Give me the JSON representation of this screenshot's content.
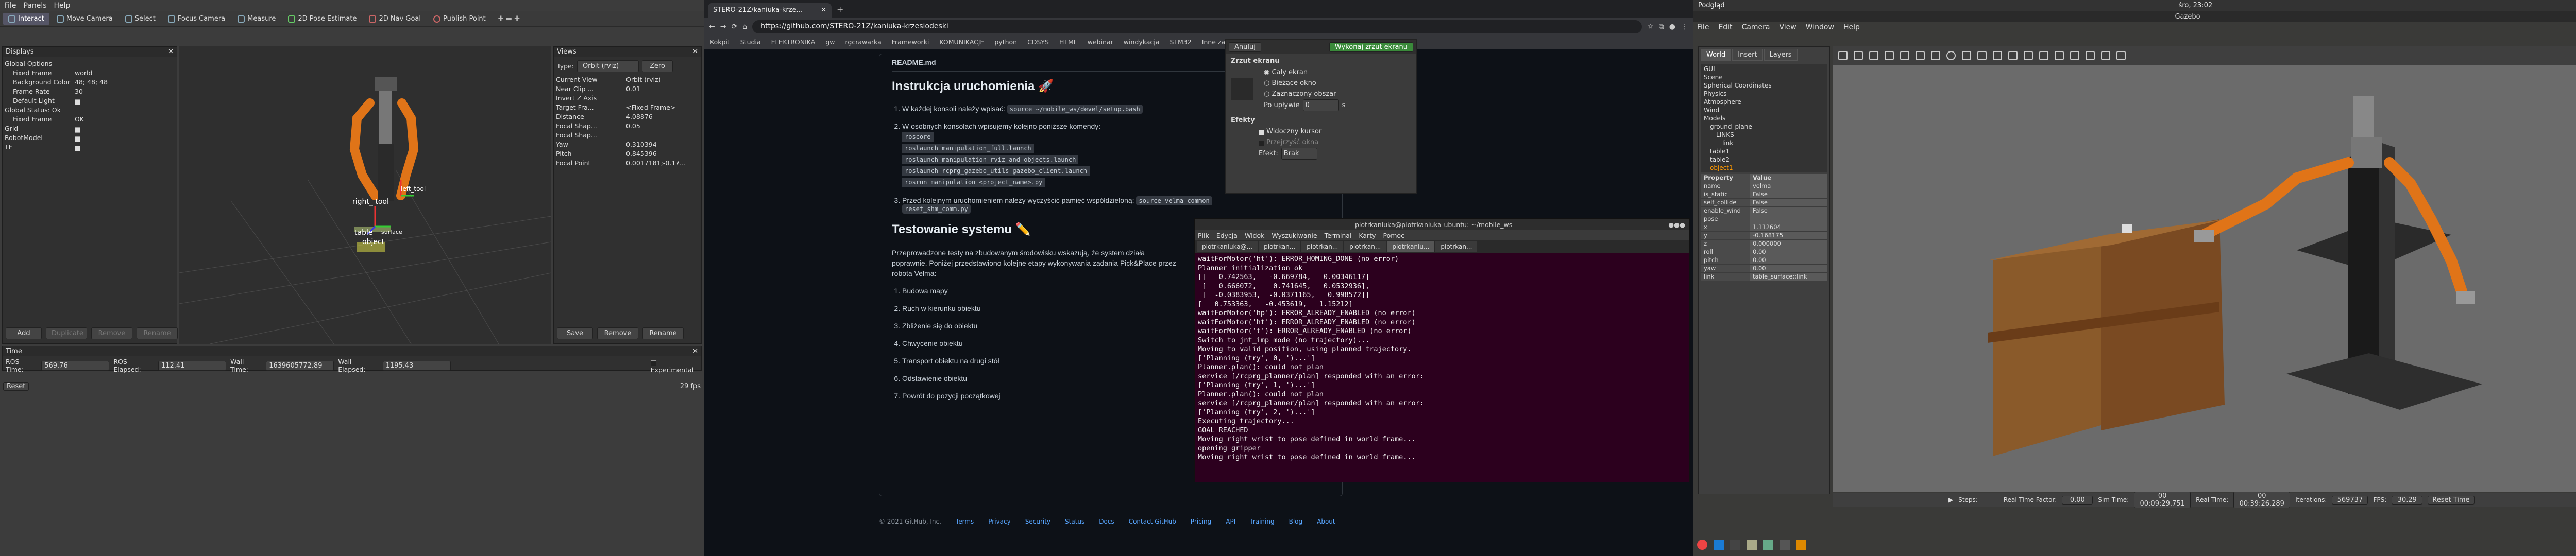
{
  "rviz": {
    "menu": [
      "File",
      "Panels",
      "Help"
    ],
    "tools": [
      "Interact",
      "Move Camera",
      "Select",
      "Focus Camera",
      "Measure",
      "2D Pose Estimate",
      "2D Nav Goal",
      "Publish Point"
    ],
    "displays_title": "Displays",
    "tree": [
      {
        "k": "Global Options",
        "v": "",
        "lvl": 0
      },
      {
        "k": "Fixed Frame",
        "v": "world",
        "lvl": 1
      },
      {
        "k": "Background Color",
        "v": "48; 48; 48",
        "lvl": 1
      },
      {
        "k": "Frame Rate",
        "v": "30",
        "lvl": 1
      },
      {
        "k": "Default Light",
        "v": "",
        "lvl": 1,
        "cb": true
      },
      {
        "k": "Global Status: Ok",
        "v": "",
        "lvl": 0
      },
      {
        "k": "Fixed Frame",
        "v": "OK",
        "lvl": 1
      },
      {
        "k": "Grid",
        "v": "",
        "lvl": 0,
        "cb": true
      },
      {
        "k": "RobotModel",
        "v": "",
        "lvl": 0,
        "cb": true
      },
      {
        "k": "TF",
        "v": "",
        "lvl": 0,
        "cb": true
      }
    ],
    "disp_buttons": [
      "Add",
      "Duplicate",
      "Remove",
      "Rename"
    ],
    "views": {
      "title": "Views",
      "type_label": "Type:",
      "type_value": "Orbit (rviz)",
      "zero": "Zero",
      "rows": [
        {
          "k": "Current View",
          "v": "Orbit (rviz)"
        },
        {
          "k": "Near Clip ...",
          "v": "0.01"
        },
        {
          "k": "Invert Z Axis",
          "v": ""
        },
        {
          "k": "Target Fra...",
          "v": "<Fixed Frame>"
        },
        {
          "k": "Distance",
          "v": "4.08876"
        },
        {
          "k": "Focal Shap...",
          "v": "0.05"
        },
        {
          "k": "Focal Shap...",
          "v": ""
        },
        {
          "k": "Yaw",
          "v": "0.310394"
        },
        {
          "k": "Pitch",
          "v": "0.845396"
        },
        {
          "k": "Focal Point",
          "v": "0.0017181;-0.17..."
        }
      ],
      "buttons": [
        "Save",
        "Remove",
        "Rename"
      ]
    },
    "labels": {
      "right_tool": "right_tool",
      "right_tool2": "right_     tool",
      "table": "table",
      "object": "object",
      "left_tool": "left_tool",
      "surface": "surface"
    },
    "time": {
      "title": "Time",
      "ros_time_label": "ROS Time:",
      "ros_time": "569.76",
      "ros_elapsed_label": "ROS Elapsed:",
      "ros_elapsed": "112.41",
      "wall_time_label": "Wall Time:",
      "wall_time": "1639605772.89",
      "wall_elapsed_label": "Wall Elapsed:",
      "wall_elapsed": "1195.43",
      "experimental": "Experimental"
    },
    "status": {
      "left": "Reset",
      "fps": "29 fps"
    }
  },
  "browser": {
    "tab_title": "STERO-21Z/kaniuka-krze...",
    "url": "https://github.com/STERO-21Z/kaniuka-krzesiodeski",
    "bookmarks": [
      "Kokpit",
      "Studia",
      "ELEKTRONIKA",
      "gw",
      "rgcrawarka",
      "Frameworki",
      "KOMUNIKACJE",
      "python",
      "CDSYS",
      "HTML",
      "webinar",
      "windykacja",
      "STM32",
      "Inne zakładki"
    ],
    "readme": "README.md",
    "h_instr": "Instrukcja uruchomienia 🚀",
    "step1_pre": "W każdej konsoli należy wpisać:",
    "step1_code": "source ~/mobile_ws/devel/setup.bash",
    "step2": "W osobnych konsolach wpisujemy kolejno poniższe komendy:",
    "cmds": [
      "roscore",
      "roslaunch manipulation_full.launch",
      "roslaunch manipulation rviz_and_objects.launch",
      "roslaunch rcprg_gazebo_utils gazebo_client.launch",
      "rosrun manipulation <project_name>.py"
    ],
    "step3_pre": "Przed kolejnym uruchomieniem należy wyczyścić pamięć współdzieloną:",
    "step3_code": "source velma_common",
    "step3_code2": "reset_shm_comm.py",
    "h_test": "Testowanie systemu ✏️",
    "test_text": "Przeprowadzone testy na zbudowanym środowisku wskazują, że system działa poprawnie. Poniżej przedstawiono kolejne etapy wykonywania zadania Pick&Place przez robota Velma:",
    "steps": [
      "Budowa mapy",
      "Ruch w kierunku obiektu",
      "Zbliżenie się do obiektu",
      "Chwycenie obiektu",
      "Transport obiektu na drugi stół",
      "Odstawienie obiektu",
      "Powrót do pozycji początkowej"
    ],
    "footer": [
      "© 2021 GitHub, Inc.",
      "Terms",
      "Privacy",
      "Security",
      "Status",
      "Docs",
      "Contact GitHub",
      "Pricing",
      "API",
      "Training",
      "Blog",
      "About"
    ],
    "shot": {
      "title": "Zrzut ekranu",
      "btn": "Wykonaj zrzut ekranu",
      "cancel": "Anuluj",
      "opts": [
        "Cały ekran",
        "Bieżące okno",
        "Zaznaczony obszar"
      ],
      "delay_label": "Po upływie",
      "delay": "0",
      "delay_unit": "s",
      "effects": "Efekty",
      "cursor": "Widoczny kursor",
      "shadow": "Przejrzyść okna",
      "effect_label": "Efekt:",
      "effect_value": "Brak"
    }
  },
  "terminal": {
    "title": "piotrkaniuka@piotrkaniuka-ubuntu: ~/mobile_ws",
    "menu": [
      "Plik",
      "Edycja",
      "Widok",
      "Wyszukiwanie",
      "Terminal",
      "Karty",
      "Pomoc"
    ],
    "tabs": [
      "piotrkaniuka@...",
      "piotrkan...",
      "piotrkan...",
      "piotrkan...",
      "piotrkaniu...",
      "piotrkan..."
    ],
    "lines": [
      "waitForMotor('ht'): ERROR_HOMING_DONE (no error)",
      "Planner initialization ok",
      "[[   0.742563,   -0.669784,   0.00346117]",
      " [   0.666072,    0.741645,   0.0532936],",
      " [  -0.0383953,  -0.0371165,   0.998572]]",
      "[   0.753363,   -0.453619,   1.15212]",
      "waitForMotor('hp'): ERROR_ALREADY_ENABLED (no error)",
      "waitForMotor('ht'): ERROR_ALREADY_ENABLED (no error)",
      "waitForMotor('t'): ERROR_ALREADY_ENABLED (no error)",
      "Switch to jnt_imp mode (no trajectory)...",
      "Moving to valid position, using planned trajectory.",
      "['Planning (try', 0, ')...']",
      "Planner.plan(): could not plan",
      "service [/rcprg_planner/plan] responded with an error:",
      "['Planning (try', 1, ')...']",
      "Planner.plan(): could not plan",
      "service [/rcprg_planner/plan] responded with an error:",
      "['Planning (try', 2, ')...']",
      "Executing trajectory...",
      "GOAL REACHED",
      "Moving right wrist to pose defined in world frame...",
      "opening gripper",
      "Moving right wrist to pose defined in world frame..."
    ]
  },
  "gazebo": {
    "top_left": "Podgląd",
    "top_right": "Gazebo",
    "clock": "śro, 23:02",
    "menu": [
      "File",
      "Edit",
      "Camera",
      "View",
      "Window",
      "Help"
    ],
    "tabs": [
      "World",
      "Insert",
      "Layers"
    ],
    "tree": [
      "GUI",
      "Scene",
      "Spherical Coordinates",
      "Physics",
      "Atmosphere",
      "Wind",
      "Models",
      "ground_plane",
      "LINKS",
      "link",
      "table1",
      "table2",
      "object1",
      "LINKS",
      "link",
      "velma"
    ],
    "prop_header": {
      "p": "Property",
      "v": "Value"
    },
    "props": [
      [
        "name",
        "velma"
      ],
      [
        "is_static",
        "False"
      ],
      [
        "self_collide",
        "False"
      ],
      [
        "enable_wind",
        "False"
      ],
      [
        "pose",
        ""
      ],
      [
        "x",
        "1.112604"
      ],
      [
        "y",
        "-0.168175"
      ],
      [
        "z",
        "0.000000"
      ],
      [
        "roll",
        "0.00"
      ],
      [
        "pitch",
        "0.00"
      ],
      [
        "yaw",
        "0.00"
      ],
      [
        "link",
        "table_surface::link"
      ]
    ],
    "bottom": {
      "steps": "Steps:",
      "factor_label": "Real Time Factor:",
      "factor": "0.00",
      "sim_label": "Sim Time:",
      "sim": "00 00:09:29.751",
      "real_label": "Real Time:",
      "real": "00 00:39:26.289",
      "iter_label": "Iterations:",
      "iter": "569737",
      "fps_label": "FPS:",
      "fps": "30.29",
      "reset": "Reset Time"
    }
  }
}
